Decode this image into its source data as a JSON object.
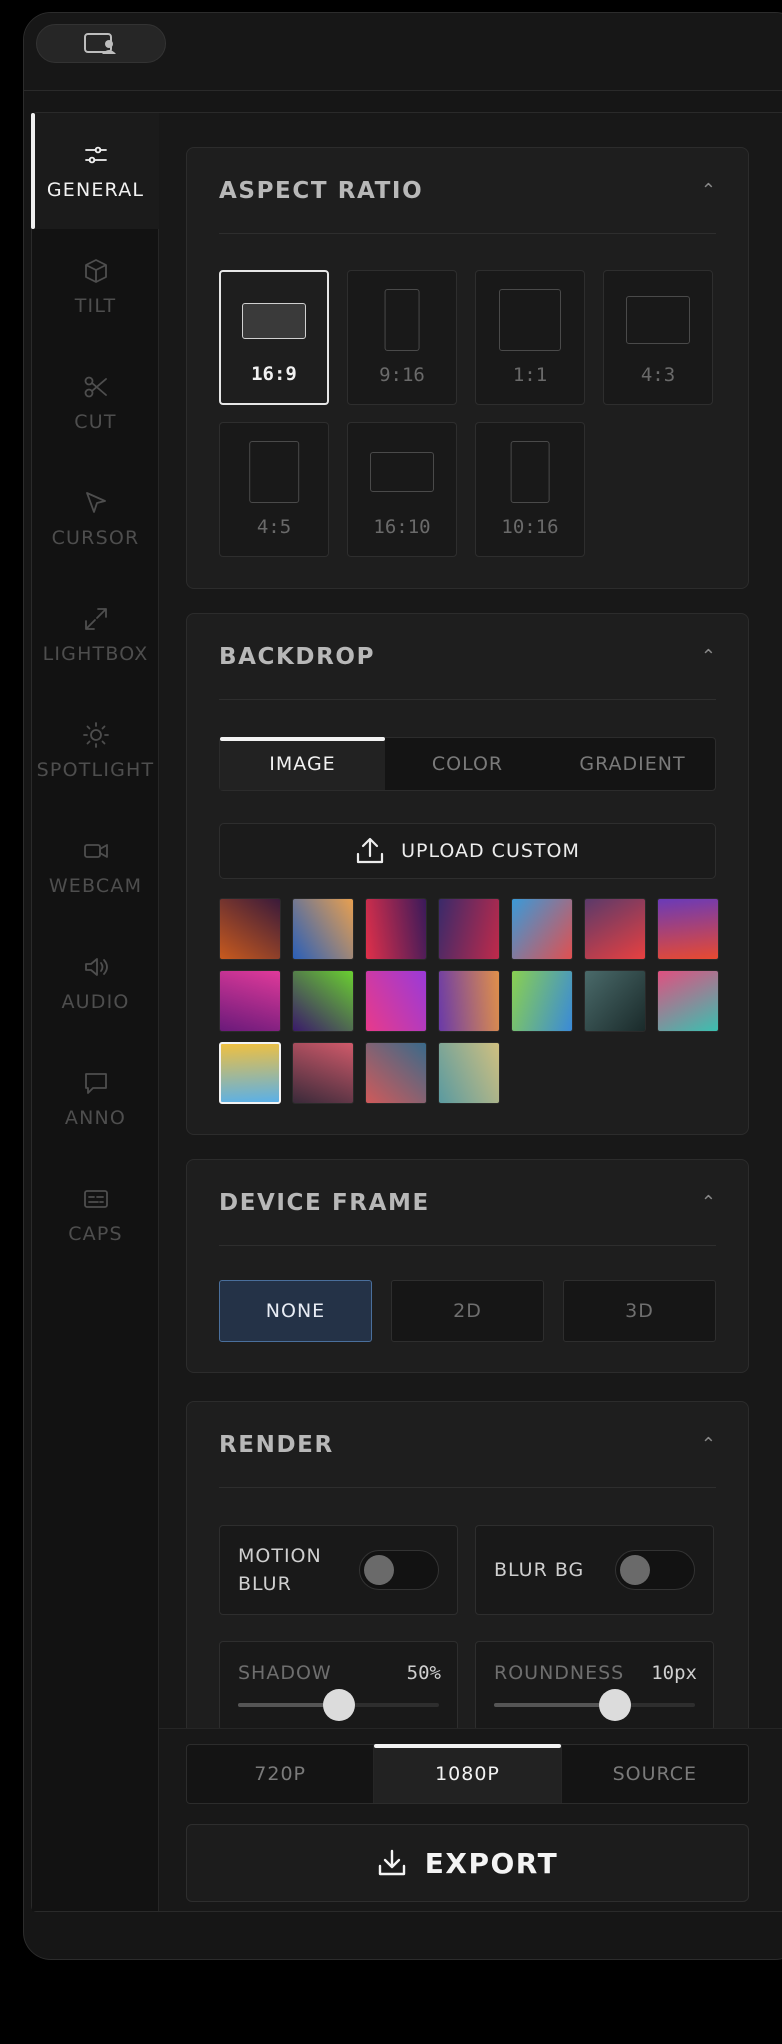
{
  "sidebar": {
    "items": [
      {
        "label": "GENERAL",
        "icon": "sliders-icon",
        "active": true
      },
      {
        "label": "TILT",
        "icon": "cube-icon"
      },
      {
        "label": "CUT",
        "icon": "scissors-icon"
      },
      {
        "label": "CURSOR",
        "icon": "cursor-icon"
      },
      {
        "label": "LIGHTBOX",
        "icon": "expand-icon"
      },
      {
        "label": "SPOTLIGHT",
        "icon": "sun-icon"
      },
      {
        "label": "WEBCAM",
        "icon": "camera-icon"
      },
      {
        "label": "AUDIO",
        "icon": "speaker-icon"
      },
      {
        "label": "ANNO",
        "icon": "chat-icon"
      },
      {
        "label": "CAPS",
        "icon": "captions-icon"
      }
    ]
  },
  "aspect_ratio": {
    "title": "ASPECT RATIO",
    "options": [
      "16:9",
      "9:16",
      "1:1",
      "4:3",
      "4:5",
      "16:10",
      "10:16"
    ],
    "selected": "16:9"
  },
  "backdrop": {
    "title": "BACKDROP",
    "tabs": [
      "IMAGE",
      "COLOR",
      "GRADIENT"
    ],
    "active_tab": "IMAGE",
    "upload_label": "UPLOAD CUSTOM",
    "thumbnail_colors": [
      [
        "#c85a1e",
        "#3a1a3a"
      ],
      [
        "#2a5fb8",
        "#e8a050"
      ],
      [
        "#e0304a",
        "#3a1a5a"
      ],
      [
        "#3a2a6a",
        "#c02a4a"
      ],
      [
        "#3a9ad8",
        "#e05050"
      ],
      [
        "#5a3a6a",
        "#e84040"
      ],
      [
        "#6a3ab8",
        "#e84a30"
      ],
      [
        "#e03a9a",
        "#6a1a7a"
      ],
      [
        "#6ad030",
        "#3a1a6a"
      ],
      [
        "#9a3ad8",
        "#e83a8a"
      ],
      [
        "#e0904a",
        "#6a3aa8"
      ],
      [
        "#3a8ad8",
        "#8ad050"
      ],
      [
        "#1a2a2a",
        "#4a6a6a"
      ],
      [
        "#3ac0b0",
        "#e05080"
      ],
      [
        "#5ab0e8",
        "#f0c040"
      ],
      [
        "#3a2a3a",
        "#d05a6a"
      ],
      [
        "#d05a5a",
        "#3a6a8a"
      ],
      [
        "#5a9aa0",
        "#d0c080"
      ]
    ]
  },
  "device_frame": {
    "title": "DEVICE FRAME",
    "options": [
      "NONE",
      "2D",
      "3D"
    ],
    "selected": "NONE"
  },
  "render": {
    "title": "RENDER",
    "motion_blur_label": "MOTION BLUR",
    "motion_blur_on": false,
    "blur_bg_label": "BLUR BG",
    "blur_bg_on": false,
    "shadow_label": "SHADOW",
    "shadow_value": "50%",
    "shadow_fraction": 0.5,
    "roundness_label": "ROUNDNESS",
    "roundness_value": "10px",
    "roundness_fraction": 0.6
  },
  "export": {
    "resolutions": [
      "720P",
      "1080P",
      "SOURCE"
    ],
    "selected_resolution": "1080P",
    "button_label": "EXPORT"
  }
}
